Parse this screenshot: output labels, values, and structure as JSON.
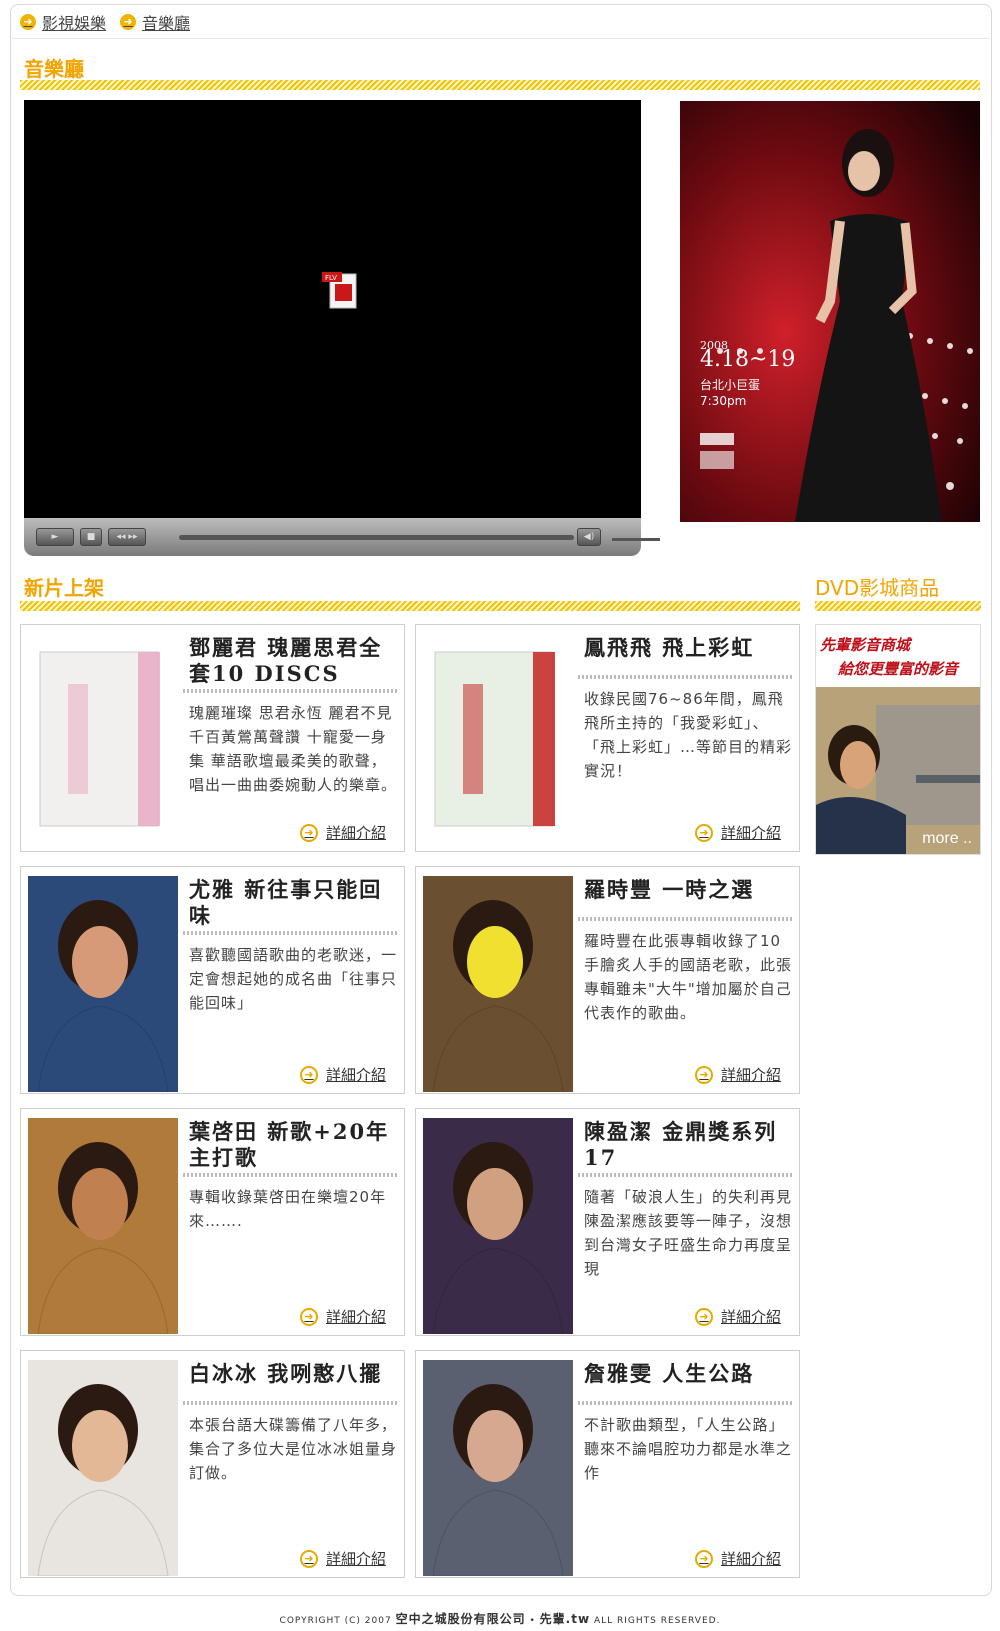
{
  "breadcrumb": [
    "影視娛樂",
    "音樂廳"
  ],
  "music_hall_title": "音樂廳",
  "new_releases_title": "新片上架",
  "dvd_title": "DVD影城商品",
  "player": {
    "badge": "FLV"
  },
  "poster": {
    "date": "2008",
    "dates": "4.18~19",
    "venue": "台北小巨蛋",
    "time": "7:30pm"
  },
  "dvd_banner": {
    "line1": "先輩影音商城",
    "line2": "給您更豐富的影音",
    "more": "more .."
  },
  "detail_label": "詳細介紹",
  "products": [
    {
      "title": "鄧麗君 瑰麗思君全套10 DISCS",
      "desc": "瑰麗璀璨 思君永恆 麗君不見 千百黃鶯萬聲讚 十寵愛一身集 華語歌壇最柔美的歌聲，唱出一曲曲委婉動人的樂章。"
    },
    {
      "title": "鳳飛飛 飛上彩虹",
      "desc": "收錄民國76~86年間，鳳飛飛所主持的「我愛彩虹」、「飛上彩虹」…等節目的精彩實況！"
    },
    {
      "title": "尤雅 新往事只能回味",
      "desc": "喜歡聽國語歌曲的老歌迷，一定會想起她的成名曲「往事只能回味」"
    },
    {
      "title": "羅時豐 一時之選",
      "desc": "羅時豐在此張專輯收錄了10手膾炙人手的國語老歌，此張專輯雖未\"大牛\"增加屬於自己代表作的歌曲。"
    },
    {
      "title": "葉啓田 新歌+20年主打歌",
      "desc": "專輯收錄葉啓田在樂壇20年來……."
    },
    {
      "title": "陳盈潔 金鼎獎系列17",
      "desc": "隨著「破浪人生」的失利再見陳盈潔應該要等一陣子，沒想到台灣女子旺盛生命力再度呈現"
    },
    {
      "title": "白冰冰 我咧憨八擺",
      "desc": "本張台語大碟籌備了八年多，集合了多位大是位冰冰姐量身訂做。"
    },
    {
      "title": "詹雅雯 人生公路",
      "desc": "不計歌曲類型，「人生公路」聽來不論唱腔功力都是水準之作"
    }
  ],
  "footer": {
    "prefix": "COPYRIGHT (C) 2007",
    "company": "空中之城股份有限公司",
    "sep": "•",
    "site": "先輩.tw",
    "suffix": "ALL RIGHTS RESERVED."
  }
}
